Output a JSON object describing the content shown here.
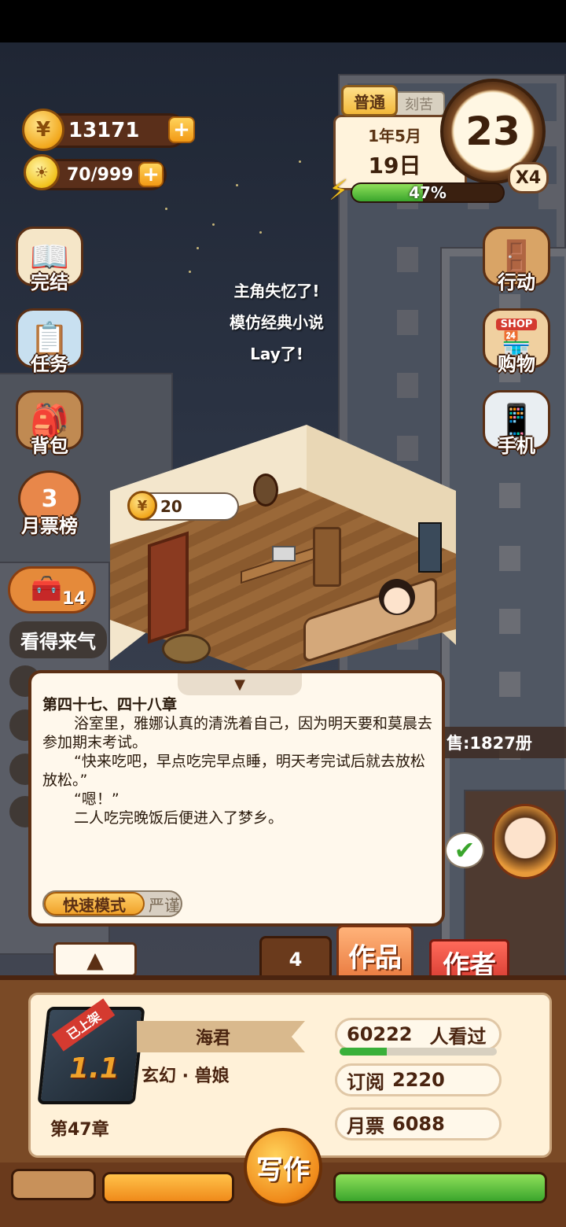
{
  "hud": {
    "gold": "13171",
    "inspiration": "70/999",
    "difficulty": "普通",
    "difficulty_alt": "刻苦",
    "date_year_month": "1年5月",
    "date_day": "19日",
    "clock_value": "23",
    "speed": "X4",
    "energy_percent": "47%",
    "energy_fraction": 0.47
  },
  "left_menu": {
    "finish": "完结",
    "tasks": "任务",
    "bag": "背包",
    "monthly_rank": "月票榜",
    "rank_badge": "3",
    "treasure_count": "14",
    "looks_lucky": "看得来气"
  },
  "right_menu": {
    "action": "行动",
    "shop": "购物",
    "shop_sign": "SHOP",
    "phone": "手机"
  },
  "story_tip": [
    "主角失忆了!",
    "模仿经典小说",
    "Lay了!"
  ],
  "room": {
    "coin_bubble": "20"
  },
  "dialog": {
    "chapter_title": "第四十七、四十八章",
    "lines": [
      "浴室里，雅娜认真的清洗着自己，因为明天要和莫晨去参加期末考试。",
      "“快来吃吧，早点吃完早点睡，明天考完试后就去放松放松。”",
      "“嗯！”",
      "二人吃完晚饭后便进入了梦乡。"
    ],
    "mode_fast": "快速模式",
    "mode_strict": "严谨"
  },
  "sales_text": "售:1827册",
  "counter_value": "4",
  "works_label": "作品",
  "author_label": "作者",
  "book": {
    "status_tag": "已上架",
    "version": "1.1",
    "author": "海君",
    "genre": "玄幻 · 兽娘",
    "chapter": "第47章",
    "views": "60222",
    "views_label": "人看过",
    "views_fraction": 0.3,
    "subscribe_label": "订阅",
    "subscribe": "2220",
    "monthly_label": "月票",
    "monthly": "6088"
  },
  "write_label": "写作"
}
